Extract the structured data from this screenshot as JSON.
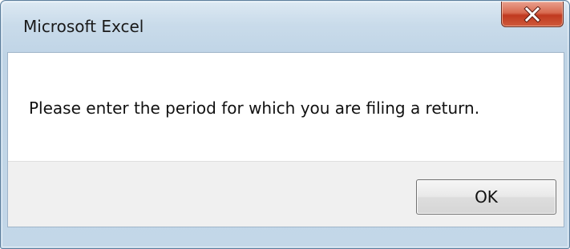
{
  "window": {
    "title": "Microsoft Excel",
    "close_icon": "close-icon"
  },
  "dialog": {
    "message": "Please enter the period for which you are filing a return.",
    "ok_label": "OK"
  },
  "colors": {
    "close_button": "#c0391f",
    "frame": "#c9dbea"
  }
}
